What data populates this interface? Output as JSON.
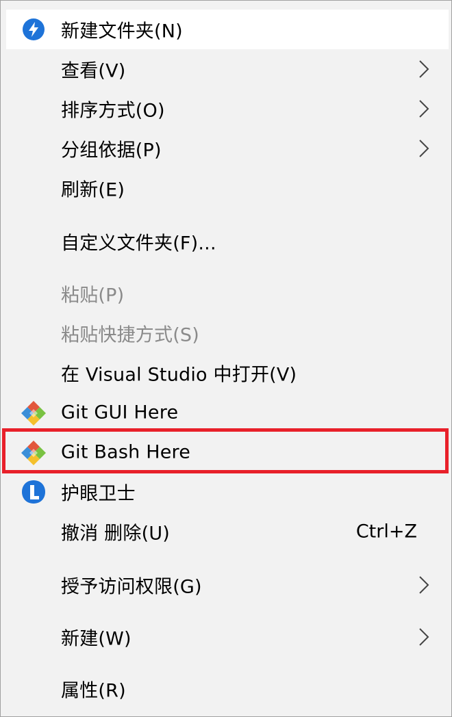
{
  "menu": {
    "items": [
      {
        "label": "新建文件夹(N)",
        "icon": "new-folder-icon"
      },
      {
        "label": "查看(V)"
      },
      {
        "label": "排序方式(O)"
      },
      {
        "label": "分组依据(P)"
      },
      {
        "label": "刷新(E)"
      },
      {
        "label": "自定义文件夹(F)..."
      },
      {
        "label": "粘贴(P)",
        "disabled": true
      },
      {
        "label": "粘贴快捷方式(S)",
        "disabled": true
      },
      {
        "label": "在 Visual Studio 中打开(V)"
      },
      {
        "label": "Git GUI Here",
        "icon": "git-icon"
      },
      {
        "label": "Git Bash Here",
        "icon": "git-icon"
      },
      {
        "label": "护眼卫士",
        "icon": "eye-guard-icon"
      },
      {
        "label": "撤消 删除(U)",
        "shortcut": "Ctrl+Z"
      },
      {
        "label": "授予访问权限(G)"
      },
      {
        "label": "新建(W)"
      },
      {
        "label": "属性(R)"
      }
    ]
  },
  "colors": {
    "menu_bg": "#f2f2f2",
    "hover_bg": "#ffffff",
    "highlight_border": "#e8202a",
    "disabled_text": "#8a8a8a",
    "accent_blue": "#1e73d8"
  }
}
